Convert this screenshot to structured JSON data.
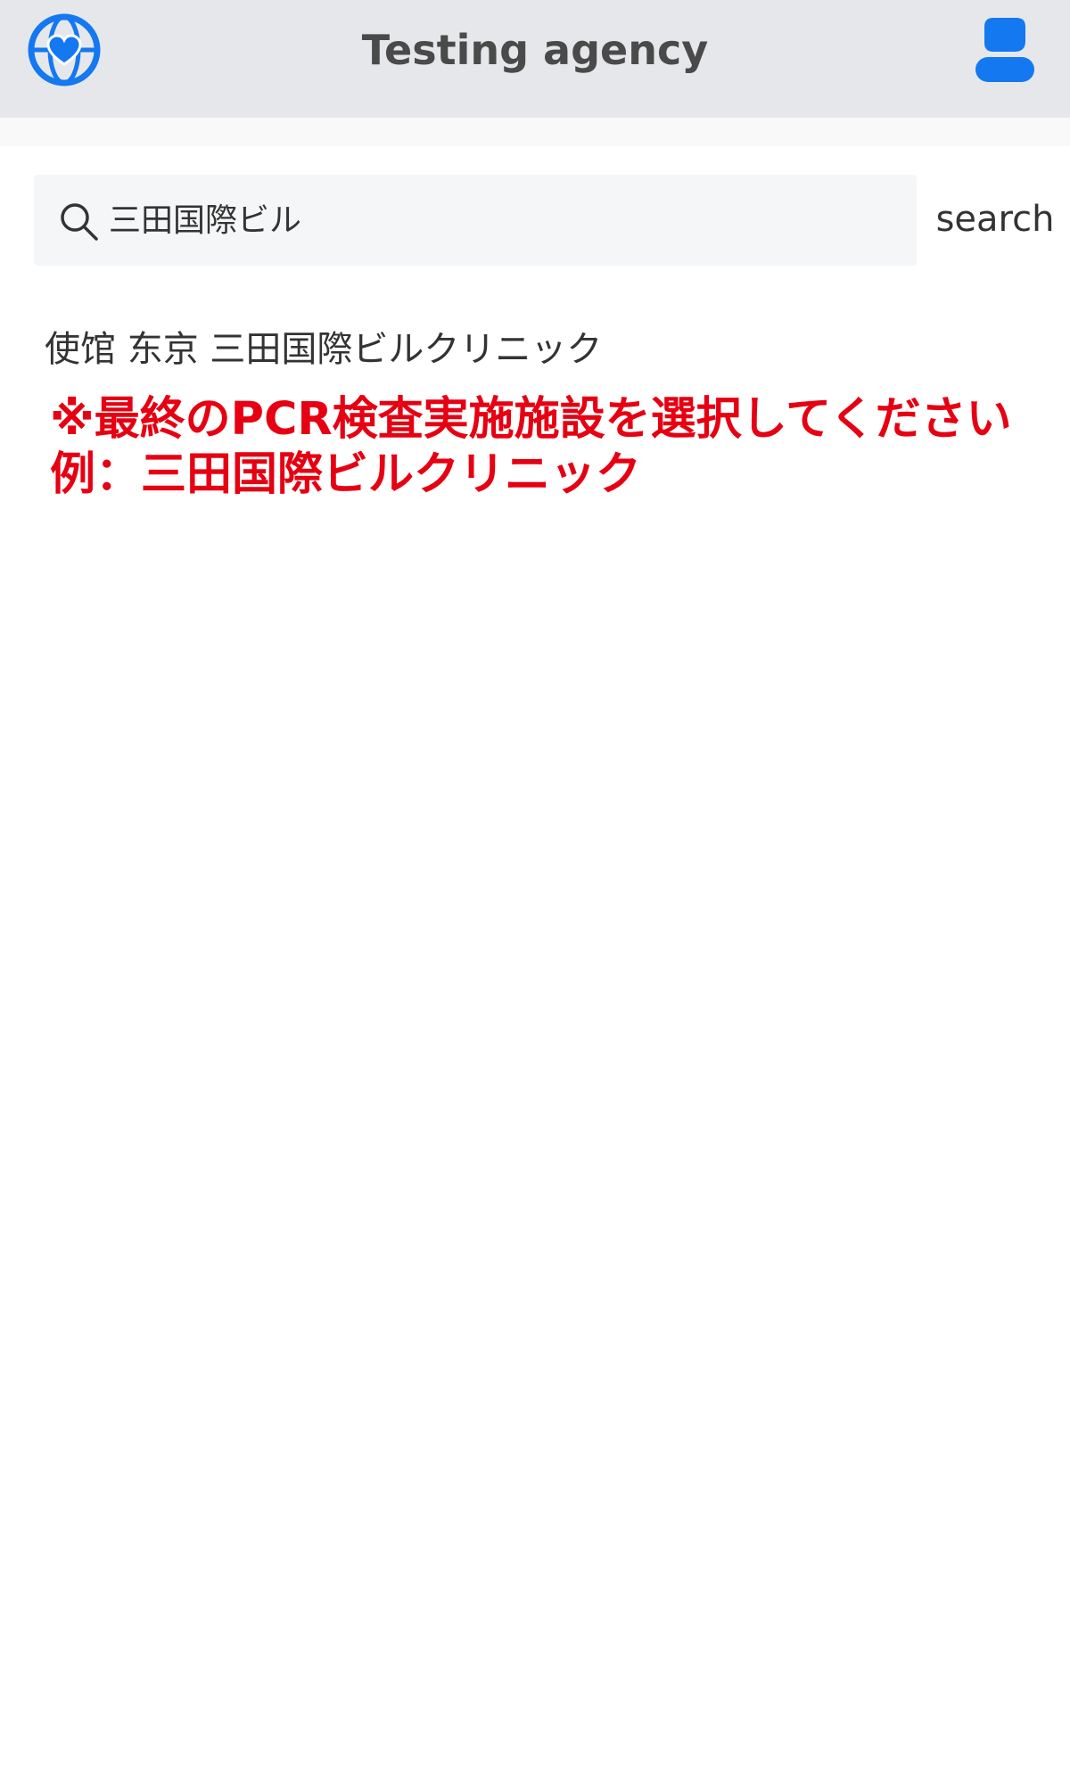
{
  "header": {
    "title": "Testing agency",
    "logo_icon": "globe-heart-icon",
    "profile_icon": "user-profile-icon",
    "accent_color": "#1478f0"
  },
  "search": {
    "value": "三田国際ビル",
    "placeholder": "",
    "button_label": "search",
    "icon": "search-icon"
  },
  "results": [
    {
      "label": "使馆 东京 三田国際ビルクリニック"
    }
  ],
  "notice": {
    "line1": "※最終のPCR検査実施施設を選択してください",
    "line2": "例：三田国際ビルクリニック",
    "color": "#e60012"
  }
}
